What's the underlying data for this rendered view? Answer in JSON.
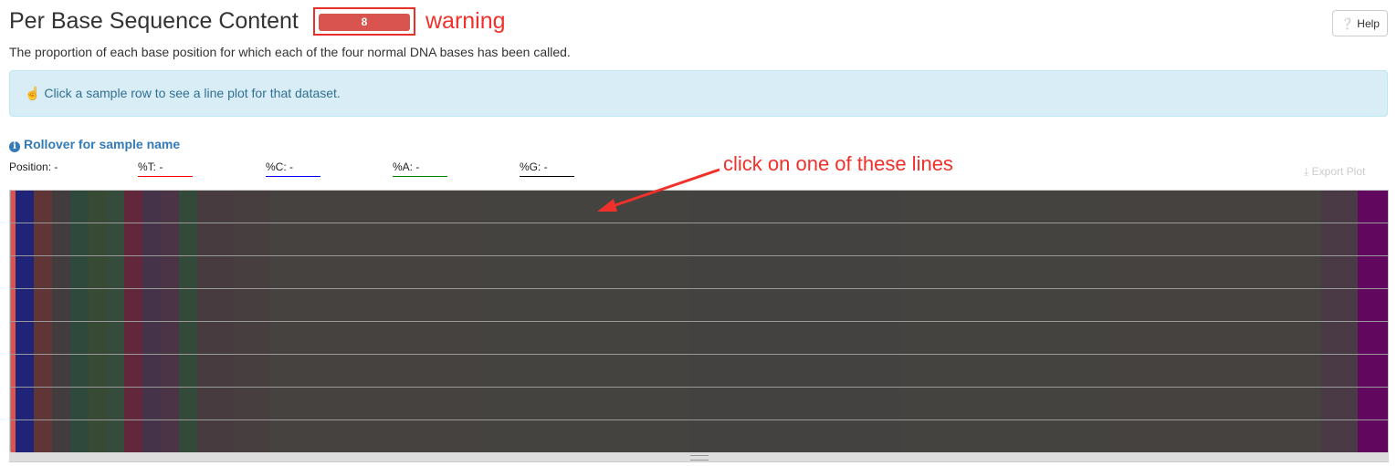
{
  "header": {
    "title": "Per Base Sequence Content",
    "badge_count": "8",
    "badge_color": "#d9534f",
    "help_label": "Help"
  },
  "description": "The proportion of each base position for which each of the four normal DNA bases has been called.",
  "alert": {
    "text": "Click a sample row to see a line plot for that dataset."
  },
  "rollover": {
    "label": "Rollover for sample name"
  },
  "readout": {
    "position": "Position: -",
    "t": "%T: -",
    "c": "%C: -",
    "a": "%A: -",
    "g": "%G: -",
    "t_color": "#ff0000",
    "c_color": "#0000ff",
    "a_color": "#008000",
    "g_color": "#000000"
  },
  "export_label": "Export Plot",
  "annotations": {
    "warning": "warning",
    "click": "click on one of these lines"
  },
  "heatmap": {
    "rows": 8,
    "row_flag_color": "#d9534f",
    "column_colors": [
      "#1f2478",
      "#5f3535",
      "#433c3e",
      "#2f4a3c",
      "#374a34",
      "#354b3b",
      "#63273b",
      "#45334a",
      "#4c3447",
      "#334a3b",
      "#483b3f",
      "#463e3f",
      "#454240",
      "#444340",
      "#434240",
      "#454340",
      "#464240",
      "#4a3a45",
      "#62075e"
    ]
  }
}
